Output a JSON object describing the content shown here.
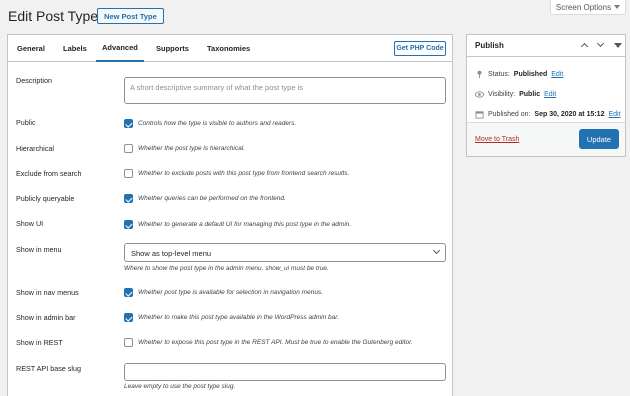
{
  "screen_options": {
    "label": "Screen Options"
  },
  "header": {
    "title": "Edit Post Type",
    "new_button": "New Post Type"
  },
  "tabs": [
    {
      "label": "General"
    },
    {
      "label": "Labels"
    },
    {
      "label": "Advanced"
    },
    {
      "label": "Supports"
    },
    {
      "label": "Taxonomies"
    }
  ],
  "active_tab": "Advanced",
  "get_php_code": "Get PHP Code",
  "fields": {
    "description": {
      "label": "Description",
      "placeholder": "A short descriptive summary of what the post type is"
    },
    "public": {
      "label": "Public",
      "desc": "Controls how the type is visible to authors and readers."
    },
    "hierarchical": {
      "label": "Hierarchical",
      "desc": "Whether the post type is hierarchical."
    },
    "exclude_from_search": {
      "label": "Exclude from search",
      "desc": "Whether to exclude posts with this post type from frontend search results."
    },
    "publicly_queryable": {
      "label": "Publicly queryable",
      "desc": "Whether queries can be performed on the frontend."
    },
    "show_ui": {
      "label": "Show UI",
      "desc": "Whether to generate a default UI for managing this post type in the admin."
    },
    "show_in_menu": {
      "label": "Show in menu",
      "selected": "Show as top-level menu",
      "desc": "Where to show the post type in the admin menu. show_ui must be true."
    },
    "show_in_nav_menus": {
      "label": "Show in nav menus",
      "desc": "Whether post type is available for selection in navigation menus."
    },
    "show_in_admin_bar": {
      "label": "Show in admin bar",
      "desc": "Whether to make this post type available in the WordPress admin bar."
    },
    "show_in_rest": {
      "label": "Show in REST",
      "desc": "Whether to expose this post type in the REST API. Must be true to enable the Gutenberg editor."
    },
    "rest_api_base_slug": {
      "label": "REST API base slug",
      "value": "",
      "desc": "Leave empty to use the post type slug."
    }
  },
  "checkbox_states": {
    "public": true,
    "hierarchical": false,
    "exclude_from_search": false,
    "publicly_queryable": true,
    "show_ui": true,
    "show_in_nav_menus": true,
    "show_in_admin_bar": true,
    "show_in_rest": false
  },
  "publish": {
    "title": "Publish",
    "status_label": "Status:",
    "status_value": "Published",
    "status_edit": "Edit",
    "visibility_label": "Visibility:",
    "visibility_value": "Public",
    "visibility_edit": "Edit",
    "published_label": "Published on:",
    "published_value": "Sep 30, 2020 at 15:12",
    "published_edit": "Edit",
    "trash": "Move to Trash",
    "update": "Update"
  },
  "colors": {
    "accent": "#2271b1",
    "trash": "#b32d2e",
    "background": "#f1f1f1"
  },
  "icons": [
    "pin-icon",
    "eye-icon",
    "calendar-icon",
    "caret-down-icon",
    "chevron-up-icon",
    "chevron-down-icon"
  ]
}
